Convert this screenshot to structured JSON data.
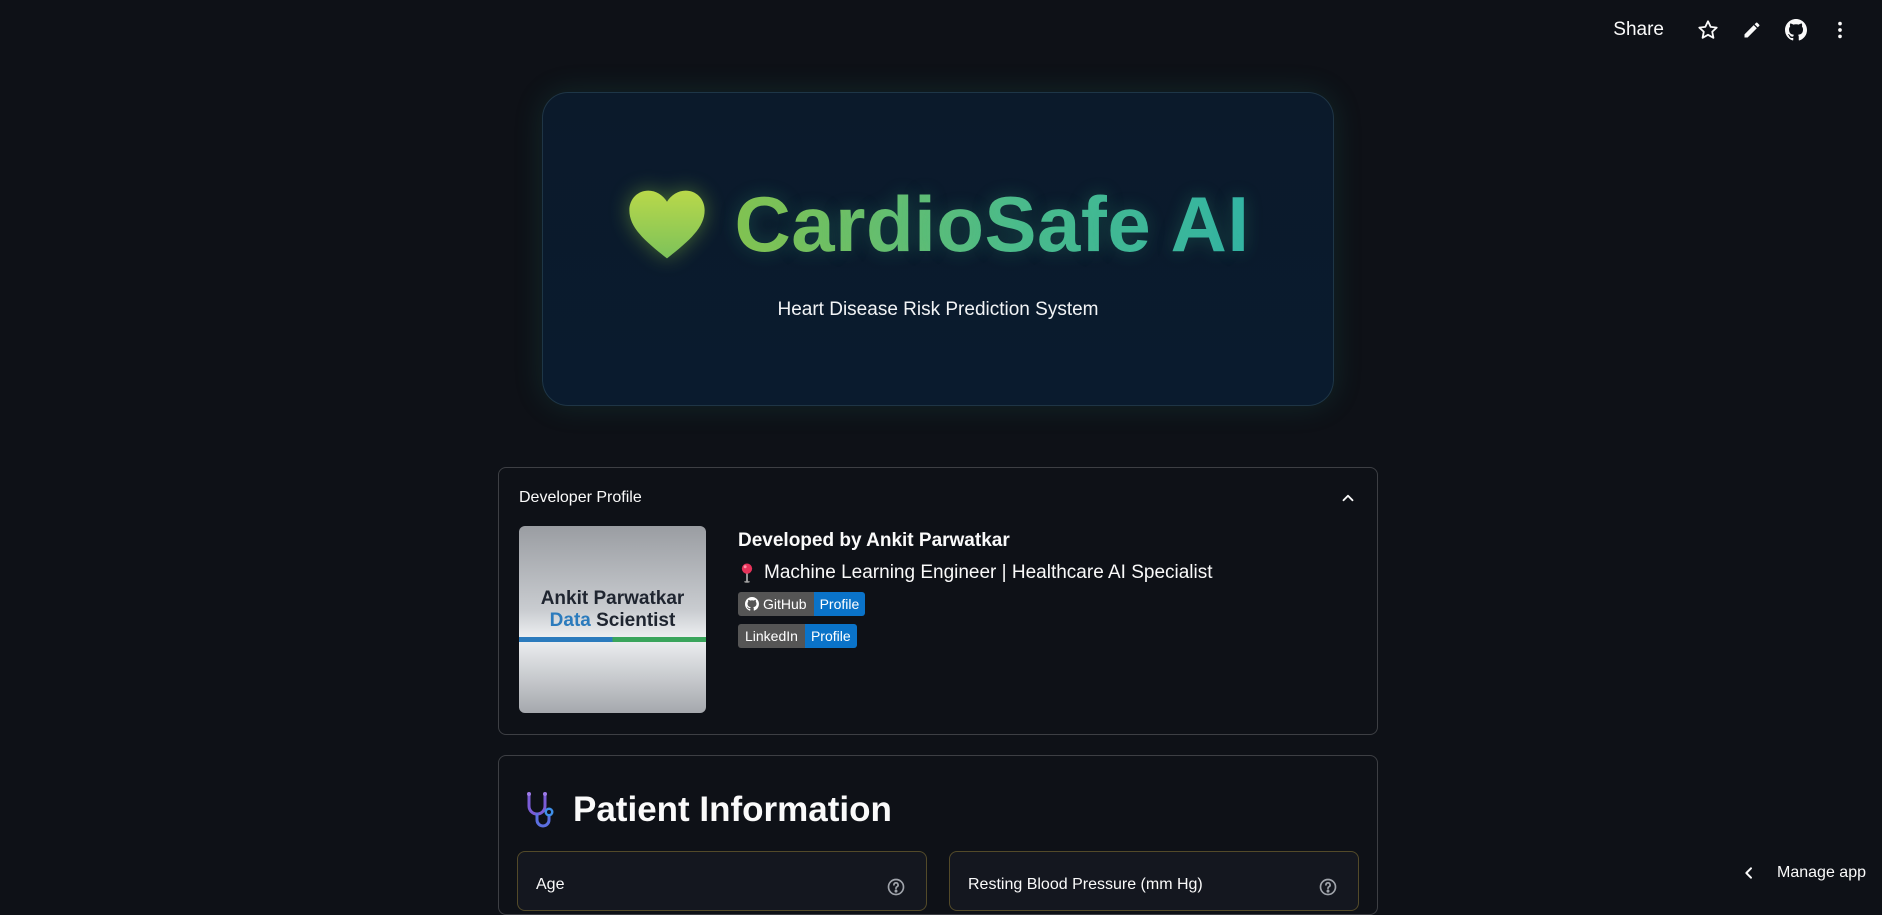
{
  "toolbar": {
    "share_label": "Share",
    "icons": [
      "star-icon",
      "pencil-icon",
      "github-icon",
      "more-vertical-icon"
    ]
  },
  "hero": {
    "title": "CardioSafe AI",
    "subtitle": "Heart Disease Risk Prediction System",
    "icon": "heart-icon",
    "colors": {
      "title_start": "#8bc34a",
      "title_end": "#33b3a6",
      "card_bg": "#0b1a2b"
    }
  },
  "developer_profile": {
    "header": "Developer Profile",
    "photo": {
      "name_text": "Ankit Parwatkar",
      "role_text_1": "Data",
      "role_text_2": "Scientist"
    },
    "developed_by": "Developed by Ankit Parwatkar",
    "role": "Machine Learning Engineer | Healthcare AI Specialist",
    "role_icon": "pin-icon",
    "badges": [
      {
        "left": "GitHub",
        "right": "Profile",
        "icon": "github-icon"
      },
      {
        "left": "LinkedIn",
        "right": "Profile"
      }
    ]
  },
  "patient_info": {
    "title": "Patient Information",
    "icon": "stethoscope-icon",
    "fields": [
      {
        "label": "Age"
      },
      {
        "label": "Resting Blood Pressure (mm Hg)"
      }
    ]
  },
  "footer": {
    "manage_app_label": "Manage app"
  },
  "theme": {
    "background": "#0e1117",
    "badge_blue": "#0a73c9",
    "badge_gray": "#555555"
  }
}
